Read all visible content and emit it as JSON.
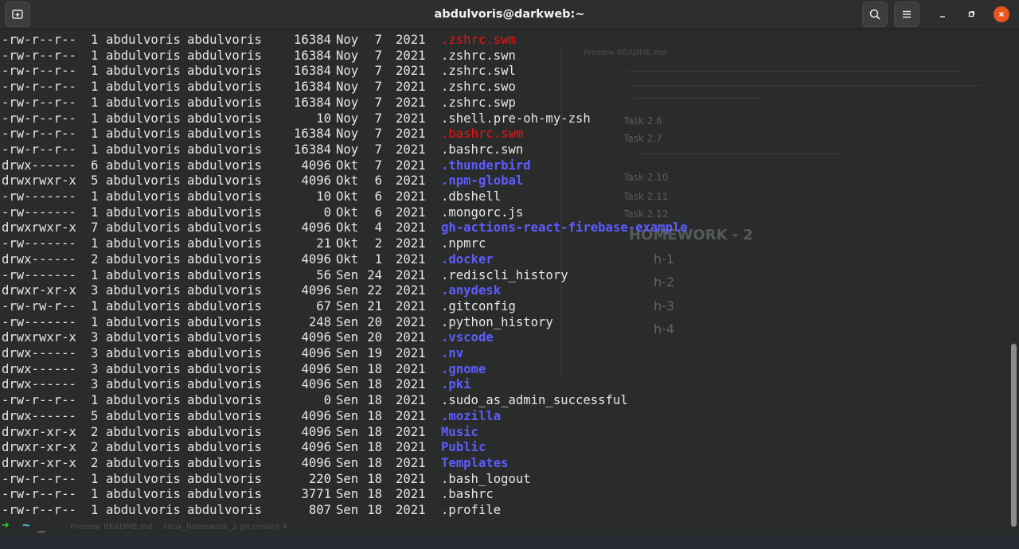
{
  "window": {
    "title": "abdulvoris@darkweb:~",
    "colors": {
      "background": "#2a2c2b",
      "directory": "#5c5cff",
      "swap_file": "#ee1111",
      "text": "#e6e6e6",
      "close": "#e95420"
    }
  },
  "toolbar": {
    "new_tab_icon": "new-tab-icon",
    "search_icon": "search-icon",
    "menu_icon": "hamburger-menu-icon",
    "minimize_label": "–",
    "maximize_label": "▫",
    "close_label": "✕"
  },
  "listing": [
    {
      "perm": "-rw-r--r--",
      "links": "1",
      "owner": "abdulvoris",
      "group": "abdulvoris",
      "size": "16384",
      "month": "Noy",
      "day": "7",
      "year": "2021",
      "name": ".zshrc.swm",
      "type": "swap"
    },
    {
      "perm": "-rw-r--r--",
      "links": "1",
      "owner": "abdulvoris",
      "group": "abdulvoris",
      "size": "16384",
      "month": "Noy",
      "day": "7",
      "year": "2021",
      "name": ".zshrc.swn",
      "type": "plain"
    },
    {
      "perm": "-rw-r--r--",
      "links": "1",
      "owner": "abdulvoris",
      "group": "abdulvoris",
      "size": "16384",
      "month": "Noy",
      "day": "7",
      "year": "2021",
      "name": ".zshrc.swl",
      "type": "plain"
    },
    {
      "perm": "-rw-r--r--",
      "links": "1",
      "owner": "abdulvoris",
      "group": "abdulvoris",
      "size": "16384",
      "month": "Noy",
      "day": "7",
      "year": "2021",
      "name": ".zshrc.swo",
      "type": "plain"
    },
    {
      "perm": "-rw-r--r--",
      "links": "1",
      "owner": "abdulvoris",
      "group": "abdulvoris",
      "size": "16384",
      "month": "Noy",
      "day": "7",
      "year": "2021",
      "name": ".zshrc.swp",
      "type": "plain"
    },
    {
      "perm": "-rw-r--r--",
      "links": "1",
      "owner": "abdulvoris",
      "group": "abdulvoris",
      "size": "10",
      "month": "Noy",
      "day": "7",
      "year": "2021",
      "name": ".shell.pre-oh-my-zsh",
      "type": "plain"
    },
    {
      "perm": "-rw-r--r--",
      "links": "1",
      "owner": "abdulvoris",
      "group": "abdulvoris",
      "size": "16384",
      "month": "Noy",
      "day": "7",
      "year": "2021",
      "name": ".bashrc.swm",
      "type": "swap"
    },
    {
      "perm": "-rw-r--r--",
      "links": "1",
      "owner": "abdulvoris",
      "group": "abdulvoris",
      "size": "16384",
      "month": "Noy",
      "day": "7",
      "year": "2021",
      "name": ".bashrc.swn",
      "type": "plain"
    },
    {
      "perm": "drwx------",
      "links": "6",
      "owner": "abdulvoris",
      "group": "abdulvoris",
      "size": "4096",
      "month": "Okt",
      "day": "7",
      "year": "2021",
      "name": ".thunderbird",
      "type": "dir"
    },
    {
      "perm": "drwxrwxr-x",
      "links": "5",
      "owner": "abdulvoris",
      "group": "abdulvoris",
      "size": "4096",
      "month": "Okt",
      "day": "6",
      "year": "2021",
      "name": ".npm-global",
      "type": "dir"
    },
    {
      "perm": "-rw-------",
      "links": "1",
      "owner": "abdulvoris",
      "group": "abdulvoris",
      "size": "10",
      "month": "Okt",
      "day": "6",
      "year": "2021",
      "name": ".dbshell",
      "type": "plain"
    },
    {
      "perm": "-rw-------",
      "links": "1",
      "owner": "abdulvoris",
      "group": "abdulvoris",
      "size": "0",
      "month": "Okt",
      "day": "6",
      "year": "2021",
      "name": ".mongorc.js",
      "type": "plain"
    },
    {
      "perm": "drwxrwxr-x",
      "links": "7",
      "owner": "abdulvoris",
      "group": "abdulvoris",
      "size": "4096",
      "month": "Okt",
      "day": "4",
      "year": "2021",
      "name": "gh-actions-react-firebase-example",
      "type": "dir"
    },
    {
      "perm": "-rw-------",
      "links": "1",
      "owner": "abdulvoris",
      "group": "abdulvoris",
      "size": "21",
      "month": "Okt",
      "day": "2",
      "year": "2021",
      "name": ".npmrc",
      "type": "plain"
    },
    {
      "perm": "drwx------",
      "links": "2",
      "owner": "abdulvoris",
      "group": "abdulvoris",
      "size": "4096",
      "month": "Okt",
      "day": "1",
      "year": "2021",
      "name": ".docker",
      "type": "dir"
    },
    {
      "perm": "-rw-------",
      "links": "1",
      "owner": "abdulvoris",
      "group": "abdulvoris",
      "size": "56",
      "month": "Sen",
      "day": "24",
      "year": "2021",
      "name": ".rediscli_history",
      "type": "plain"
    },
    {
      "perm": "drwxr-xr-x",
      "links": "3",
      "owner": "abdulvoris",
      "group": "abdulvoris",
      "size": "4096",
      "month": "Sen",
      "day": "22",
      "year": "2021",
      "name": ".anydesk",
      "type": "dir"
    },
    {
      "perm": "-rw-rw-r--",
      "links": "1",
      "owner": "abdulvoris",
      "group": "abdulvoris",
      "size": "67",
      "month": "Sen",
      "day": "21",
      "year": "2021",
      "name": ".gitconfig",
      "type": "plain"
    },
    {
      "perm": "-rw-------",
      "links": "1",
      "owner": "abdulvoris",
      "group": "abdulvoris",
      "size": "248",
      "month": "Sen",
      "day": "20",
      "year": "2021",
      "name": ".python_history",
      "type": "plain"
    },
    {
      "perm": "drwxrwxr-x",
      "links": "3",
      "owner": "abdulvoris",
      "group": "abdulvoris",
      "size": "4096",
      "month": "Sen",
      "day": "20",
      "year": "2021",
      "name": ".vscode",
      "type": "dir"
    },
    {
      "perm": "drwx------",
      "links": "3",
      "owner": "abdulvoris",
      "group": "abdulvoris",
      "size": "4096",
      "month": "Sen",
      "day": "19",
      "year": "2021",
      "name": ".nv",
      "type": "dir"
    },
    {
      "perm": "drwx------",
      "links": "3",
      "owner": "abdulvoris",
      "group": "abdulvoris",
      "size": "4096",
      "month": "Sen",
      "day": "18",
      "year": "2021",
      "name": ".gnome",
      "type": "dir"
    },
    {
      "perm": "drwx------",
      "links": "3",
      "owner": "abdulvoris",
      "group": "abdulvoris",
      "size": "4096",
      "month": "Sen",
      "day": "18",
      "year": "2021",
      "name": ".pki",
      "type": "dir"
    },
    {
      "perm": "-rw-r--r--",
      "links": "1",
      "owner": "abdulvoris",
      "group": "abdulvoris",
      "size": "0",
      "month": "Sen",
      "day": "18",
      "year": "2021",
      "name": ".sudo_as_admin_successful",
      "type": "plain"
    },
    {
      "perm": "drwx------",
      "links": "5",
      "owner": "abdulvoris",
      "group": "abdulvoris",
      "size": "4096",
      "month": "Sen",
      "day": "18",
      "year": "2021",
      "name": ".mozilla",
      "type": "dir"
    },
    {
      "perm": "drwxr-xr-x",
      "links": "2",
      "owner": "abdulvoris",
      "group": "abdulvoris",
      "size": "4096",
      "month": "Sen",
      "day": "18",
      "year": "2021",
      "name": "Music",
      "type": "dir"
    },
    {
      "perm": "drwxr-xr-x",
      "links": "2",
      "owner": "abdulvoris",
      "group": "abdulvoris",
      "size": "4096",
      "month": "Sen",
      "day": "18",
      "year": "2021",
      "name": "Public",
      "type": "dir"
    },
    {
      "perm": "drwxr-xr-x",
      "links": "2",
      "owner": "abdulvoris",
      "group": "abdulvoris",
      "size": "4096",
      "month": "Sen",
      "day": "18",
      "year": "2021",
      "name": "Templates",
      "type": "dir"
    },
    {
      "perm": "-rw-r--r--",
      "links": "1",
      "owner": "abdulvoris",
      "group": "abdulvoris",
      "size": "220",
      "month": "Sen",
      "day": "18",
      "year": "2021",
      "name": ".bash_logout",
      "type": "plain"
    },
    {
      "perm": "-rw-r--r--",
      "links": "1",
      "owner": "abdulvoris",
      "group": "abdulvoris",
      "size": "3771",
      "month": "Sen",
      "day": "18",
      "year": "2021",
      "name": ".bashrc",
      "type": "plain"
    },
    {
      "perm": "-rw-r--r--",
      "links": "1",
      "owner": "abdulvoris",
      "group": "abdulvoris",
      "size": "807",
      "month": "Sen",
      "day": "18",
      "year": "2021",
      "name": ".profile",
      "type": "plain"
    }
  ],
  "prompt": {
    "arrow": "➜",
    "cwd": "~",
    "cursor": "_"
  },
  "background_editor": {
    "tab_title": "Preview README.md",
    "tasks": [
      "Task 2.6",
      "Task 2.7",
      "Task 2.10",
      "Task 2.11",
      "Task 2.12"
    ],
    "homework_title": "HOMEWORK - 2",
    "homework_items": [
      "h-1",
      "h-2",
      "h-3",
      "h-4"
    ],
    "bottom_tab": "Preview README.md",
    "git_line": "linux_homework_2 git:(main) ✗"
  }
}
